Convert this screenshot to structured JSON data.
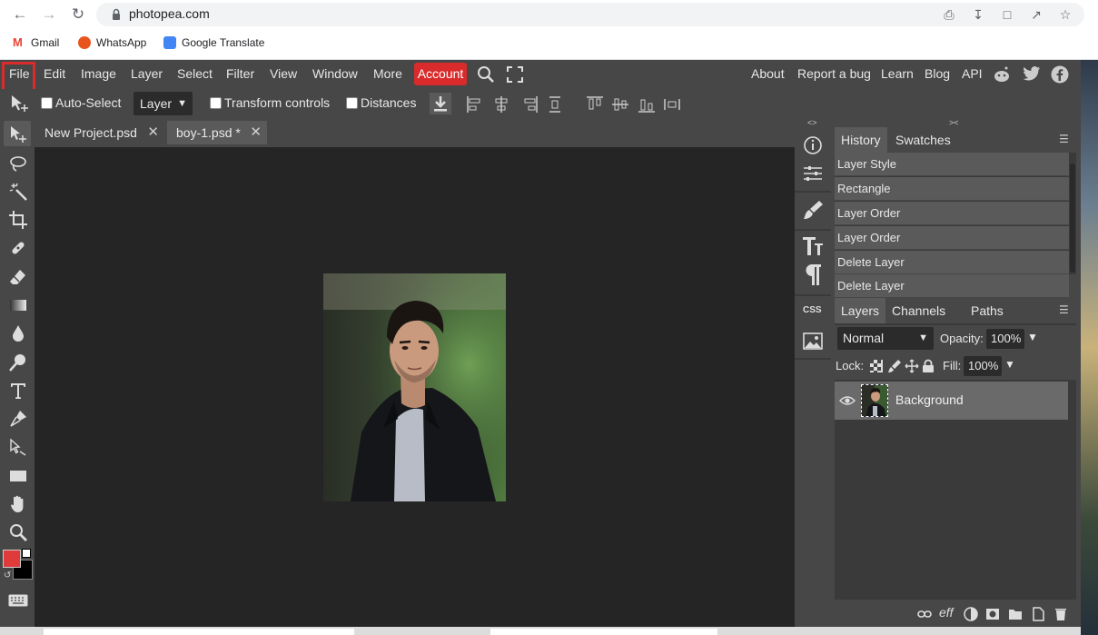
{
  "browser": {
    "url": "photopea.com",
    "bookmarks": [
      {
        "label": "Gmail",
        "icon": "gmail-icon",
        "color": "#ea4335"
      },
      {
        "label": "WhatsApp",
        "icon": "whatsapp-icon",
        "color": "#e8541c"
      },
      {
        "label": "Google Translate",
        "icon": "translate-icon",
        "color": "#4285f4"
      }
    ]
  },
  "menubar": {
    "items": [
      "File",
      "Edit",
      "Image",
      "Layer",
      "Select",
      "Filter",
      "View",
      "Window",
      "More"
    ],
    "account": "Account",
    "right_links": [
      "About",
      "Report a bug",
      "Learn",
      "Blog",
      "API"
    ],
    "highlighted_item": "File",
    "highlight_color": "#d92b2b"
  },
  "options": {
    "auto_select_label": "Auto-Select",
    "auto_select_target": "Layer",
    "transform_controls_label": "Transform controls",
    "distances_label": "Distances"
  },
  "documents": {
    "tabs": [
      {
        "name": "New Project.psd",
        "active": false
      },
      {
        "name": "boy-1.psd *",
        "active": true
      }
    ]
  },
  "history": {
    "tabs": [
      "History",
      "Swatches"
    ],
    "items": [
      "Layer Style",
      "Rectangle",
      "Layer Order",
      "Layer Order",
      "Delete Layer",
      "Delete Layer"
    ]
  },
  "layers": {
    "tabs": [
      "Layers",
      "Channels",
      "Paths"
    ],
    "blend_mode": "Normal",
    "opacity_label": "Opacity:",
    "opacity": "100%",
    "lock_label": "Lock:",
    "fill_label": "Fill:",
    "fill": "100%",
    "items": [
      {
        "name": "Background",
        "visible": true
      }
    ]
  },
  "colors": {
    "foreground": "#e03a3a",
    "background": "#000000",
    "accent": "#d92b2b"
  }
}
